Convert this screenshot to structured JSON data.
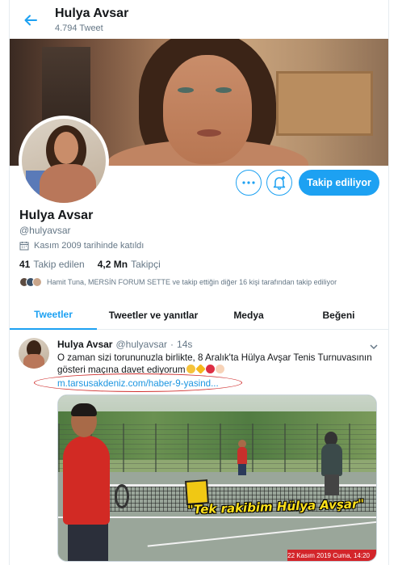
{
  "header": {
    "name": "Hulya Avsar",
    "tweet_count": "4.794 Tweet"
  },
  "profile": {
    "name": "Hulya Avsar",
    "handle": "@hulyavsar",
    "joined": "Kasım 2009 tarihinde katıldı",
    "following_count": "41",
    "following_label": "Takip edilen",
    "followers_count": "4,2 Mn",
    "followers_label": "Takipçi",
    "followed_by": "Hamit Tuna, MERSİN FORUM SETTE ve takip ettiğin diğer 16 kişi tarafından takip ediliyor",
    "follow_button": "Takip ediliyor"
  },
  "tabs": [
    {
      "label": "Tweetler",
      "active": true
    },
    {
      "label": "Tweetler ve yanıtlar",
      "active": false
    },
    {
      "label": "Medya",
      "active": false
    },
    {
      "label": "Beğeni",
      "active": false
    }
  ],
  "tweet": {
    "name": "Hulya Avsar",
    "handle": "@hulyavsar",
    "sep": "·",
    "time": "14s",
    "text_line1": "O zaman sizi  torununuzla birlikte, 8 Aralık'ta Hülya Avşar Tenis Turnuvasının",
    "text_line2": "gösteri maçına davet ediyorum",
    "link": "m.tarsusakdeniz.com/haber-9-yasind...",
    "media": {
      "caption": "\"Tek rakibim Hülya Avşar\"",
      "date": "22 Kasım 2019 Cuma, 14:20"
    }
  },
  "colors": {
    "accent": "#1da1f2",
    "link": "#1b95e0",
    "secondary_text": "#657786",
    "annotation_red": "#d0302f"
  }
}
